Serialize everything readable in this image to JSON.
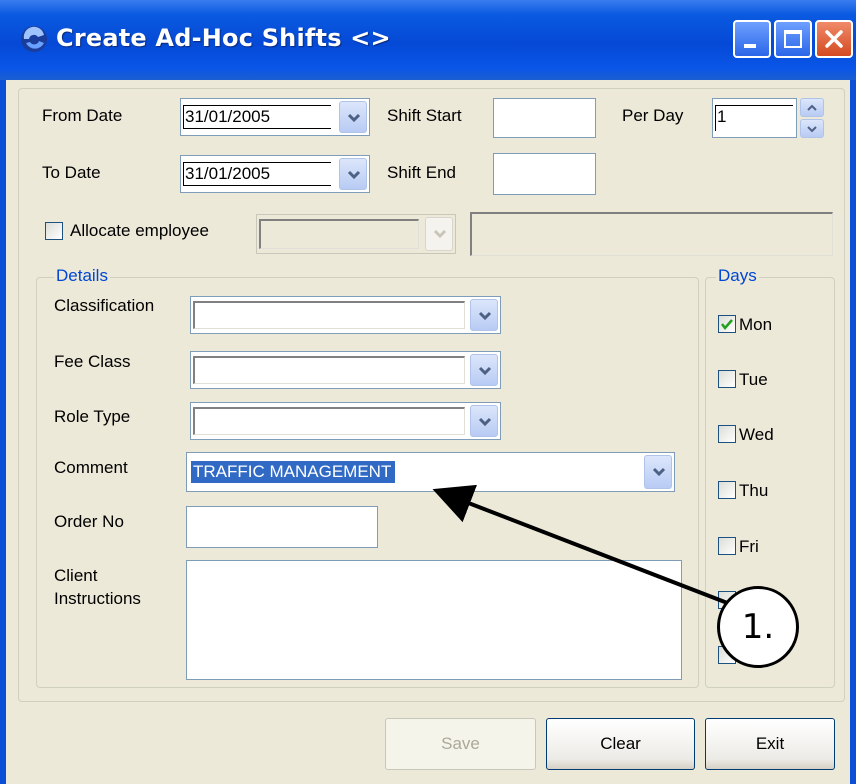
{
  "window": {
    "title": "Create Ad-Hoc Shifts <>",
    "icons": [
      "app-icon",
      "minimize-icon",
      "maximize-icon",
      "close-icon"
    ]
  },
  "form": {
    "from_date_label": "From Date",
    "from_date_value": "31/01/2005",
    "to_date_label": "To Date",
    "to_date_value": "31/01/2005",
    "shift_start_label": "Shift Start",
    "shift_start_value": "",
    "shift_end_label": "Shift End",
    "shift_end_value": "",
    "per_day_label": "Per Day",
    "per_day_value": "1",
    "allocate_label": "Allocate employee",
    "allocate_checked": false
  },
  "details": {
    "group_title": "Details",
    "classification_label": "Classification",
    "classification_value": "",
    "fee_class_label": "Fee Class",
    "fee_class_value": "",
    "role_type_label": "Role Type",
    "role_type_value": "",
    "comment_label": "Comment",
    "comment_value": "TRAFFIC MANAGEMENT",
    "order_no_label": "Order No",
    "order_no_value": "",
    "client_instr_label_1": "Client",
    "client_instr_label_2": "Instructions",
    "client_instr_value": ""
  },
  "days": {
    "group_title": "Days",
    "items": [
      {
        "label": "Mon",
        "checked": true
      },
      {
        "label": "Tue",
        "checked": false
      },
      {
        "label": "Wed",
        "checked": false
      },
      {
        "label": "Thu",
        "checked": false
      },
      {
        "label": "Fri",
        "checked": false
      },
      {
        "label": "",
        "checked": false
      },
      {
        "label": "",
        "checked": false
      }
    ]
  },
  "buttons": {
    "save": "Save",
    "clear": "Clear",
    "exit": "Exit"
  },
  "callout": {
    "label": "1."
  },
  "colors": {
    "titlebar": "#0549d6",
    "window_bg": "#ece9d8",
    "group_title": "#0046d5",
    "selection": "#316ac5"
  }
}
